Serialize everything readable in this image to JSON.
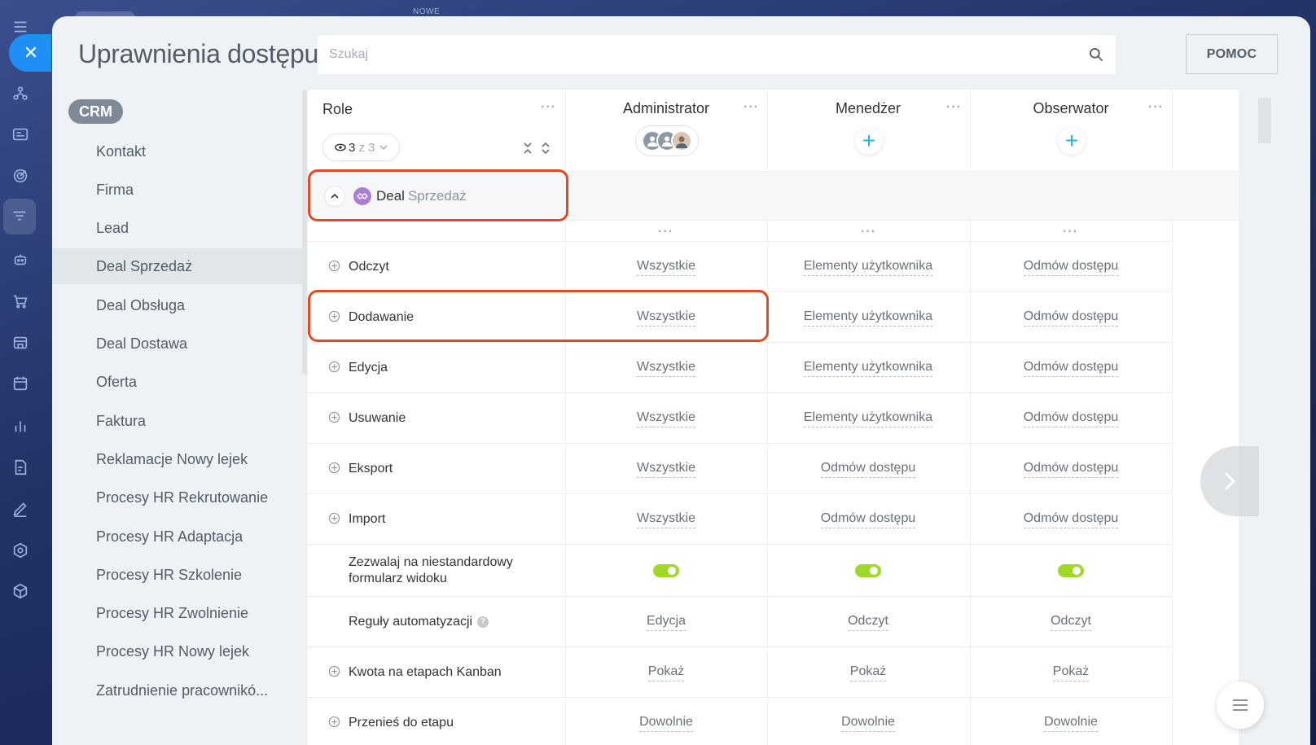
{
  "background": {
    "nowe_label": "NOWE"
  },
  "panel": {
    "title": "Uprawnienia dostępu",
    "search_placeholder": "Szukaj",
    "help_label": "POMOC"
  },
  "menu": {
    "badge": "CRM",
    "items": [
      {
        "label": "Kontakt"
      },
      {
        "label": "Firma"
      },
      {
        "label": "Lead"
      },
      {
        "label": "Deal Sprzedaż",
        "selected": true
      },
      {
        "label": "Deal Obsługa"
      },
      {
        "label": "Deal Dostawa"
      },
      {
        "label": "Oferta"
      },
      {
        "label": "Faktura"
      },
      {
        "label": "Reklamacje Nowy lejek"
      },
      {
        "label": "Procesy HR Rekrutowanie"
      },
      {
        "label": "Procesy HR Adaptacja"
      },
      {
        "label": "Procesy HR Szkolenie"
      },
      {
        "label": "Procesy HR Zwolnienie"
      },
      {
        "label": "Procesy HR Nowy lejek"
      },
      {
        "label": "Zatrudnienie pracownikó..."
      }
    ]
  },
  "table": {
    "roles_header": "Role",
    "role_filter": {
      "count": "3",
      "of": "z 3"
    },
    "roles": [
      {
        "name": "Administrator"
      },
      {
        "name": "Menedżer"
      },
      {
        "name": "Obserwator"
      }
    ],
    "section": {
      "name": "Deal",
      "sub": "Sprzedaż"
    },
    "rows": [
      {
        "label": "Odczyt",
        "expandable": true,
        "values": [
          "Wszystkie",
          "Elementy użytkownika",
          "Odmów dostępu"
        ]
      },
      {
        "label": "Dodawanie",
        "expandable": true,
        "values": [
          "Wszystkie",
          "Elementy użytkownika",
          "Odmów dostępu"
        ]
      },
      {
        "label": "Edycja",
        "expandable": true,
        "values": [
          "Wszystkie",
          "Elementy użytkownika",
          "Odmów dostępu"
        ]
      },
      {
        "label": "Usuwanie",
        "expandable": true,
        "values": [
          "Wszystkie",
          "Elementy użytkownika",
          "Odmów dostępu"
        ]
      },
      {
        "label": "Eksport",
        "expandable": true,
        "values": [
          "Wszystkie",
          "Odmów dostępu",
          "Odmów dostępu"
        ]
      },
      {
        "label": "Import",
        "expandable": true,
        "values": [
          "Wszystkie",
          "Odmów dostępu",
          "Odmów dostępu"
        ]
      },
      {
        "label": "Zezwalaj na niestandardowy formularz widoku",
        "expandable": false,
        "toggle": true,
        "values": [
          "on",
          "on",
          "on"
        ]
      },
      {
        "label": "Reguły automatyzacji",
        "expandable": false,
        "help": true,
        "values": [
          "Edycja",
          "Odczyt",
          "Odczyt"
        ]
      },
      {
        "label": "Kwota na etapach Kanban",
        "expandable": true,
        "values": [
          "Pokaż",
          "Pokaż",
          "Pokaż"
        ]
      },
      {
        "label": "Przenieś do etapu",
        "expandable": true,
        "values": [
          "Dowolnie",
          "Dowolnie",
          "Dowolnie"
        ]
      }
    ]
  },
  "colors": {
    "accent": "#1f8ff5",
    "highlight": "#e24a24",
    "toggle_on": "#9ed92a",
    "plus": "#1fb5f1"
  }
}
